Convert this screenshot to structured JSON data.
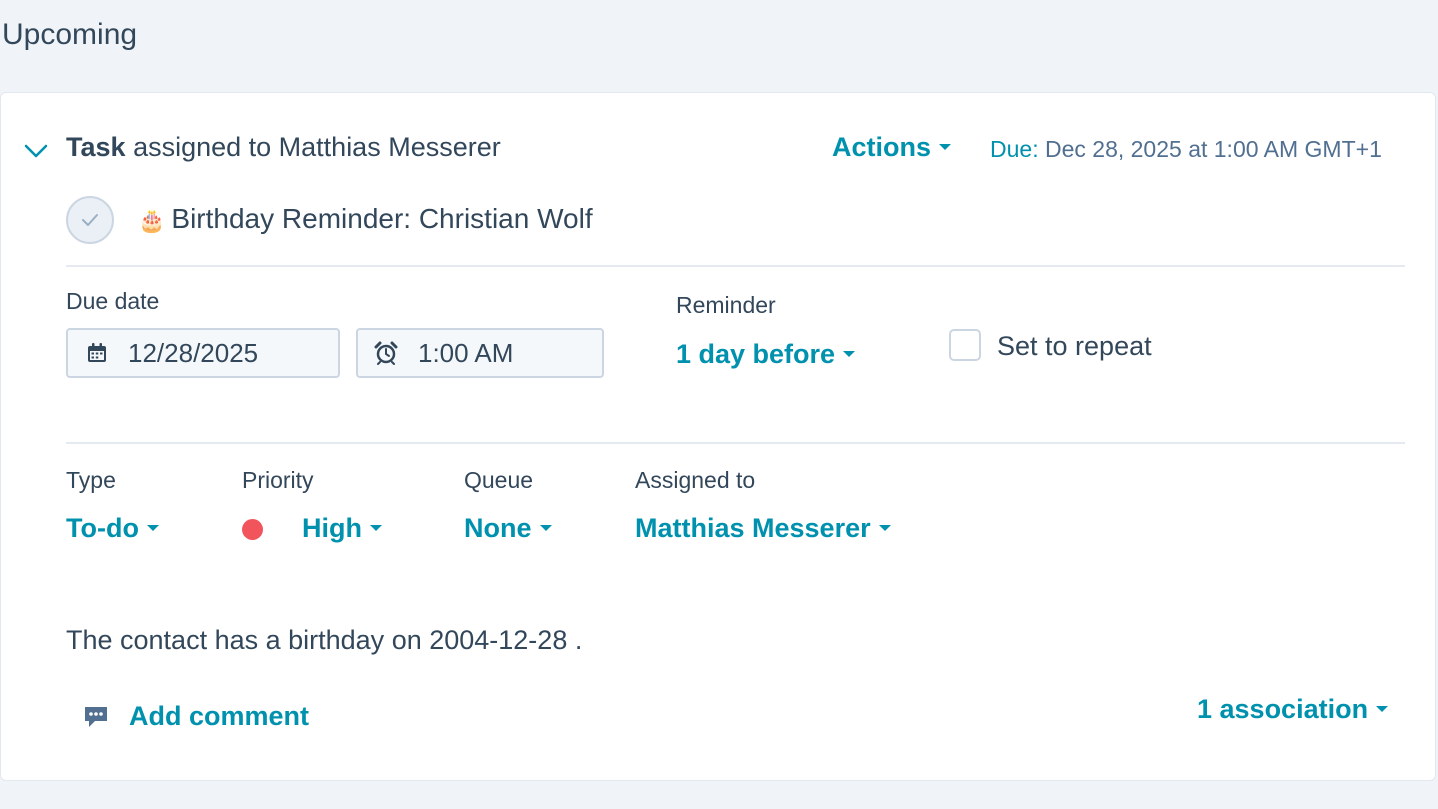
{
  "section": {
    "title": "Upcoming"
  },
  "task": {
    "type_label": "Task",
    "assigned_text": "assigned to Matthias Messerer",
    "actions_label": "Actions",
    "due_label": "Due:",
    "due_value": "Dec 28, 2025 at 1:00 AM GMT+1",
    "title": "Birthday Reminder: Christian Wolf",
    "title_emoji": "🎂",
    "due_date": {
      "label": "Due date",
      "date_value": "12/28/2025",
      "time_value": "1:00 AM"
    },
    "reminder": {
      "label": "Reminder",
      "value": "1 day before"
    },
    "repeat": {
      "label": "Set to repeat",
      "checked": false
    },
    "type": {
      "label": "Type",
      "value": "To-do"
    },
    "priority": {
      "label": "Priority",
      "value": "High",
      "color": "#f2545b"
    },
    "queue": {
      "label": "Queue",
      "value": "None"
    },
    "assigned_to": {
      "label": "Assigned to",
      "value": "Matthias Messerer"
    },
    "body_text": "The contact has a birthday on 2004-12-28 .",
    "add_comment_label": "Add comment",
    "associations_label": "1 association"
  },
  "colors": {
    "accent": "#0091ae",
    "text": "#33475b",
    "page_bg": "#f0f4f8"
  }
}
